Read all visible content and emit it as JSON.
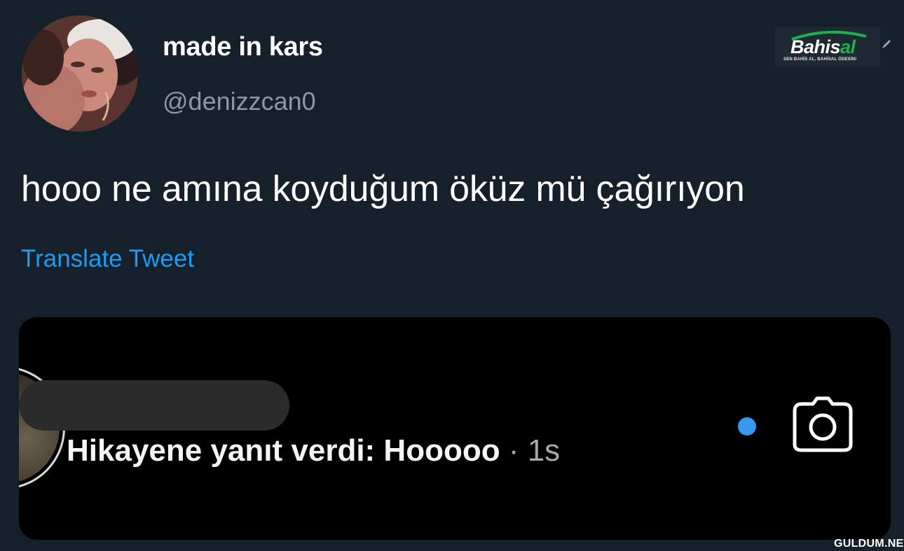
{
  "author": {
    "display_name": "made in kars",
    "handle": "@denizzcan0"
  },
  "brand_logo": {
    "name_main": "Bahis",
    "name_accent": "al",
    "tagline": "SEN BAHİS AL, BAHİSAL ÖDESİN!",
    "accent_color": "#1fb24a"
  },
  "tweet": {
    "text": "hooo ne amına koyduğum öküz mü çağırıyon",
    "translate_label": "Translate Tweet",
    "link_color": "#1d9bf0"
  },
  "embedded_notification": {
    "message": "Hikayene yanıt verdi: Hooooo",
    "separator": "·",
    "time": "1s",
    "unread_color": "#3897f0",
    "icons": [
      "camera-icon"
    ]
  },
  "watermark": "GULDUM.NET"
}
